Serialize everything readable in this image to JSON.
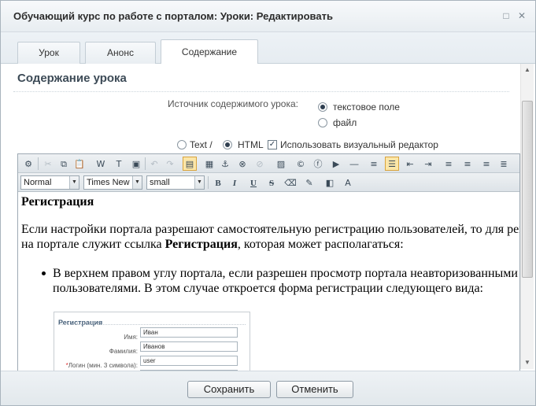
{
  "window": {
    "title": "Обучающий курс по работе с порталом: Уроки: Редактировать"
  },
  "tabs": [
    {
      "label": "Урок"
    },
    {
      "label": "Анонс"
    },
    {
      "label": "Содержание"
    }
  ],
  "section": {
    "title": "Содержание урока",
    "source_label": "Источник содержимого урока:",
    "source_options": [
      "текстовое поле",
      "файл"
    ],
    "source_selected": "текстовое поле"
  },
  "format": {
    "text_label": "Text /",
    "html_label": "HTML",
    "selected": "HTML",
    "visual_editor_label": "Использовать визуальный редактор",
    "visual_editor_checked": true
  },
  "editor": {
    "style_select": "Normal",
    "font_select": "Times New",
    "size_select": "small",
    "toolbar2_labels": {
      "bold": "B",
      "italic": "I",
      "underline": "U",
      "strike": "S"
    },
    "doc": {
      "heading": "Регистрация",
      "para1_line1": "Если настройки портала разрешают самостоятельную регистрацию пользователей, то для регистрации",
      "para1_line2_pre": "на портале служит ссылка ",
      "para1_line2_bold": "Регистрация",
      "para1_line2_post": ", которая может располагаться:",
      "bullet_line1": "В верхнем правом углу портала, если разрешен просмотр портала неавторизованными",
      "bullet_line2": "пользователями. В этом случае откроется форма регистрации следующего вида:",
      "screenshot": {
        "title": "Регистрация",
        "fields": [
          {
            "label": "Имя:",
            "value": "Иван",
            "required": false
          },
          {
            "label": "Фамилия:",
            "value": "Иванов",
            "required": false
          },
          {
            "label": "Логин (мин. 3 символа):",
            "value": "user",
            "required": true
          }
        ]
      }
    }
  },
  "footer": {
    "save_label": "Сохранить",
    "cancel_label": "Отменить"
  }
}
